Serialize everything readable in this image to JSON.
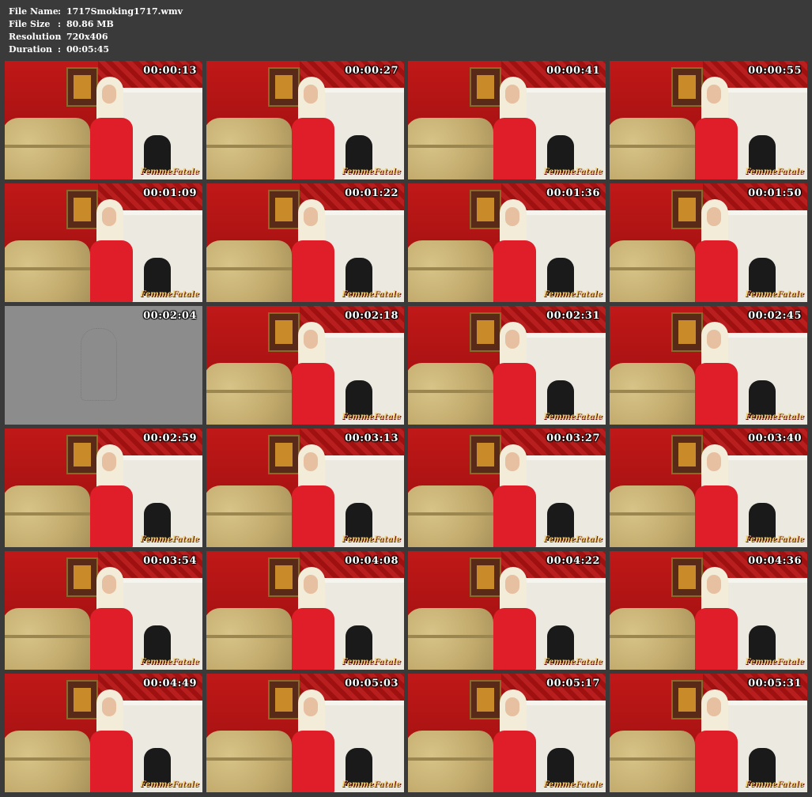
{
  "file_info": {
    "rows": [
      {
        "label": "File Name",
        "value": "1717Smoking1717.wmv"
      },
      {
        "label": "File Size",
        "value": "80.86 MB"
      },
      {
        "label": "Resolution",
        "value": "720x406"
      },
      {
        "label": "Duration",
        "value": "00:05:45"
      }
    ],
    "separator": ":"
  },
  "thumbnails": [
    {
      "time": "00:00:13",
      "logo": "FemmeFatale"
    },
    {
      "time": "00:00:27",
      "logo": "FemmeFatale"
    },
    {
      "time": "00:00:41",
      "logo": "FemmeFatale"
    },
    {
      "time": "00:00:55",
      "logo": "FemmeFatale"
    },
    {
      "time": "00:01:09",
      "logo": "FemmeFatale"
    },
    {
      "time": "00:01:22",
      "logo": "FemmeFatale"
    },
    {
      "time": "00:01:36",
      "logo": "FemmeFatale"
    },
    {
      "time": "00:01:50",
      "logo": "FemmeFatale"
    },
    {
      "time": "00:02:04",
      "logo": "",
      "gray": true
    },
    {
      "time": "00:02:18",
      "logo": "FemmeFatale"
    },
    {
      "time": "00:02:31",
      "logo": "FemmeFatale"
    },
    {
      "time": "00:02:45",
      "logo": "FemmeFatale"
    },
    {
      "time": "00:02:59",
      "logo": "FemmeFatale"
    },
    {
      "time": "00:03:13",
      "logo": "FemmeFatale"
    },
    {
      "time": "00:03:27",
      "logo": "FemmeFatale"
    },
    {
      "time": "00:03:40",
      "logo": "FemmeFatale"
    },
    {
      "time": "00:03:54",
      "logo": "FemmeFatale"
    },
    {
      "time": "00:04:08",
      "logo": "FemmeFatale"
    },
    {
      "time": "00:04:22",
      "logo": "FemmeFatale"
    },
    {
      "time": "00:04:36",
      "logo": "FemmeFatale"
    },
    {
      "time": "00:04:49",
      "logo": "FemmeFatale"
    },
    {
      "time": "00:05:03",
      "logo": "FemmeFatale"
    },
    {
      "time": "00:05:17",
      "logo": "FemmeFatale"
    },
    {
      "time": "00:05:31",
      "logo": "FemmeFatale"
    }
  ],
  "colors": {
    "background": "#3a3a3a",
    "text": "#ffffff",
    "wall": "#c01818",
    "dress": "#e01e2a"
  }
}
